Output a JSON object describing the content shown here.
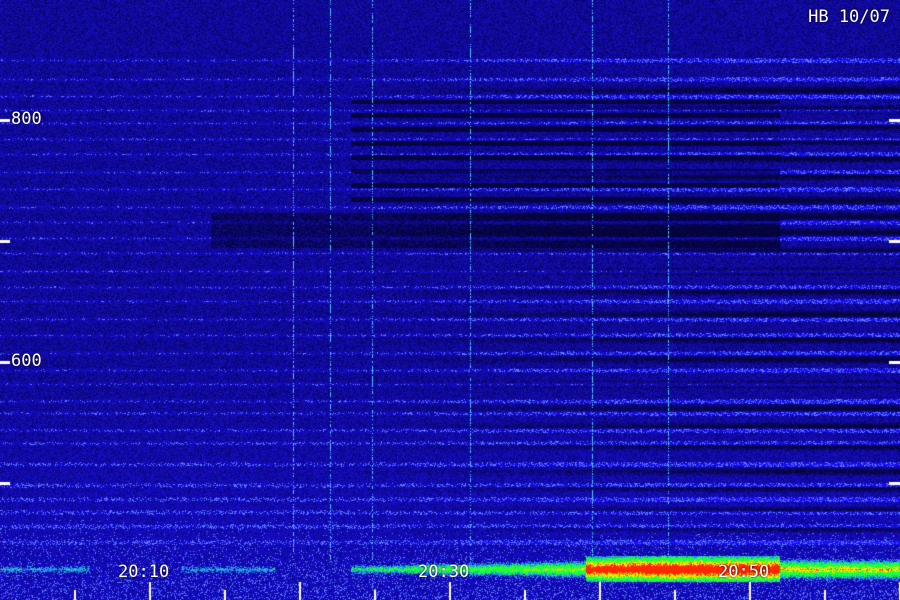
{
  "station_label": "HB 10/07",
  "frequency_labels": [
    "800",
    "600"
  ],
  "time_labels": [
    "20:10",
    "20:30",
    "20:50"
  ],
  "colors": {
    "background": "#0a0630",
    "noise": "#2a18c8",
    "band": "#3a2ae8",
    "streak": "#5ab8ff",
    "hot_green": "#22ff44",
    "hot_yellow": "#ffee00",
    "hot_red": "#ff2a00",
    "axis": "#ffffff"
  }
}
